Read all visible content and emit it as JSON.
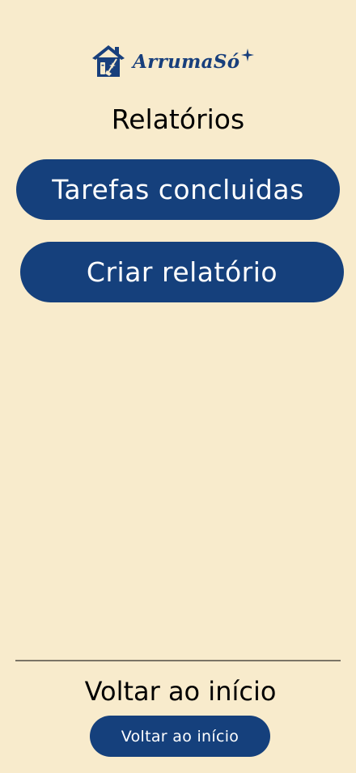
{
  "brand": {
    "name": "ArrumaSó",
    "logo_icon": "house-cleaning-icon",
    "sparkle_icon": "sparkle-icon",
    "color": "#183f7c"
  },
  "page": {
    "title": "Relatórios",
    "background": "#f8ebcc"
  },
  "actions": {
    "completed_tasks_label": "Tarefas concluidas",
    "create_report_label": "Criar relatório",
    "button_color": "#15407c"
  },
  "footer": {
    "title": "Voltar ao início",
    "back_button_label": "Voltar ao início"
  }
}
